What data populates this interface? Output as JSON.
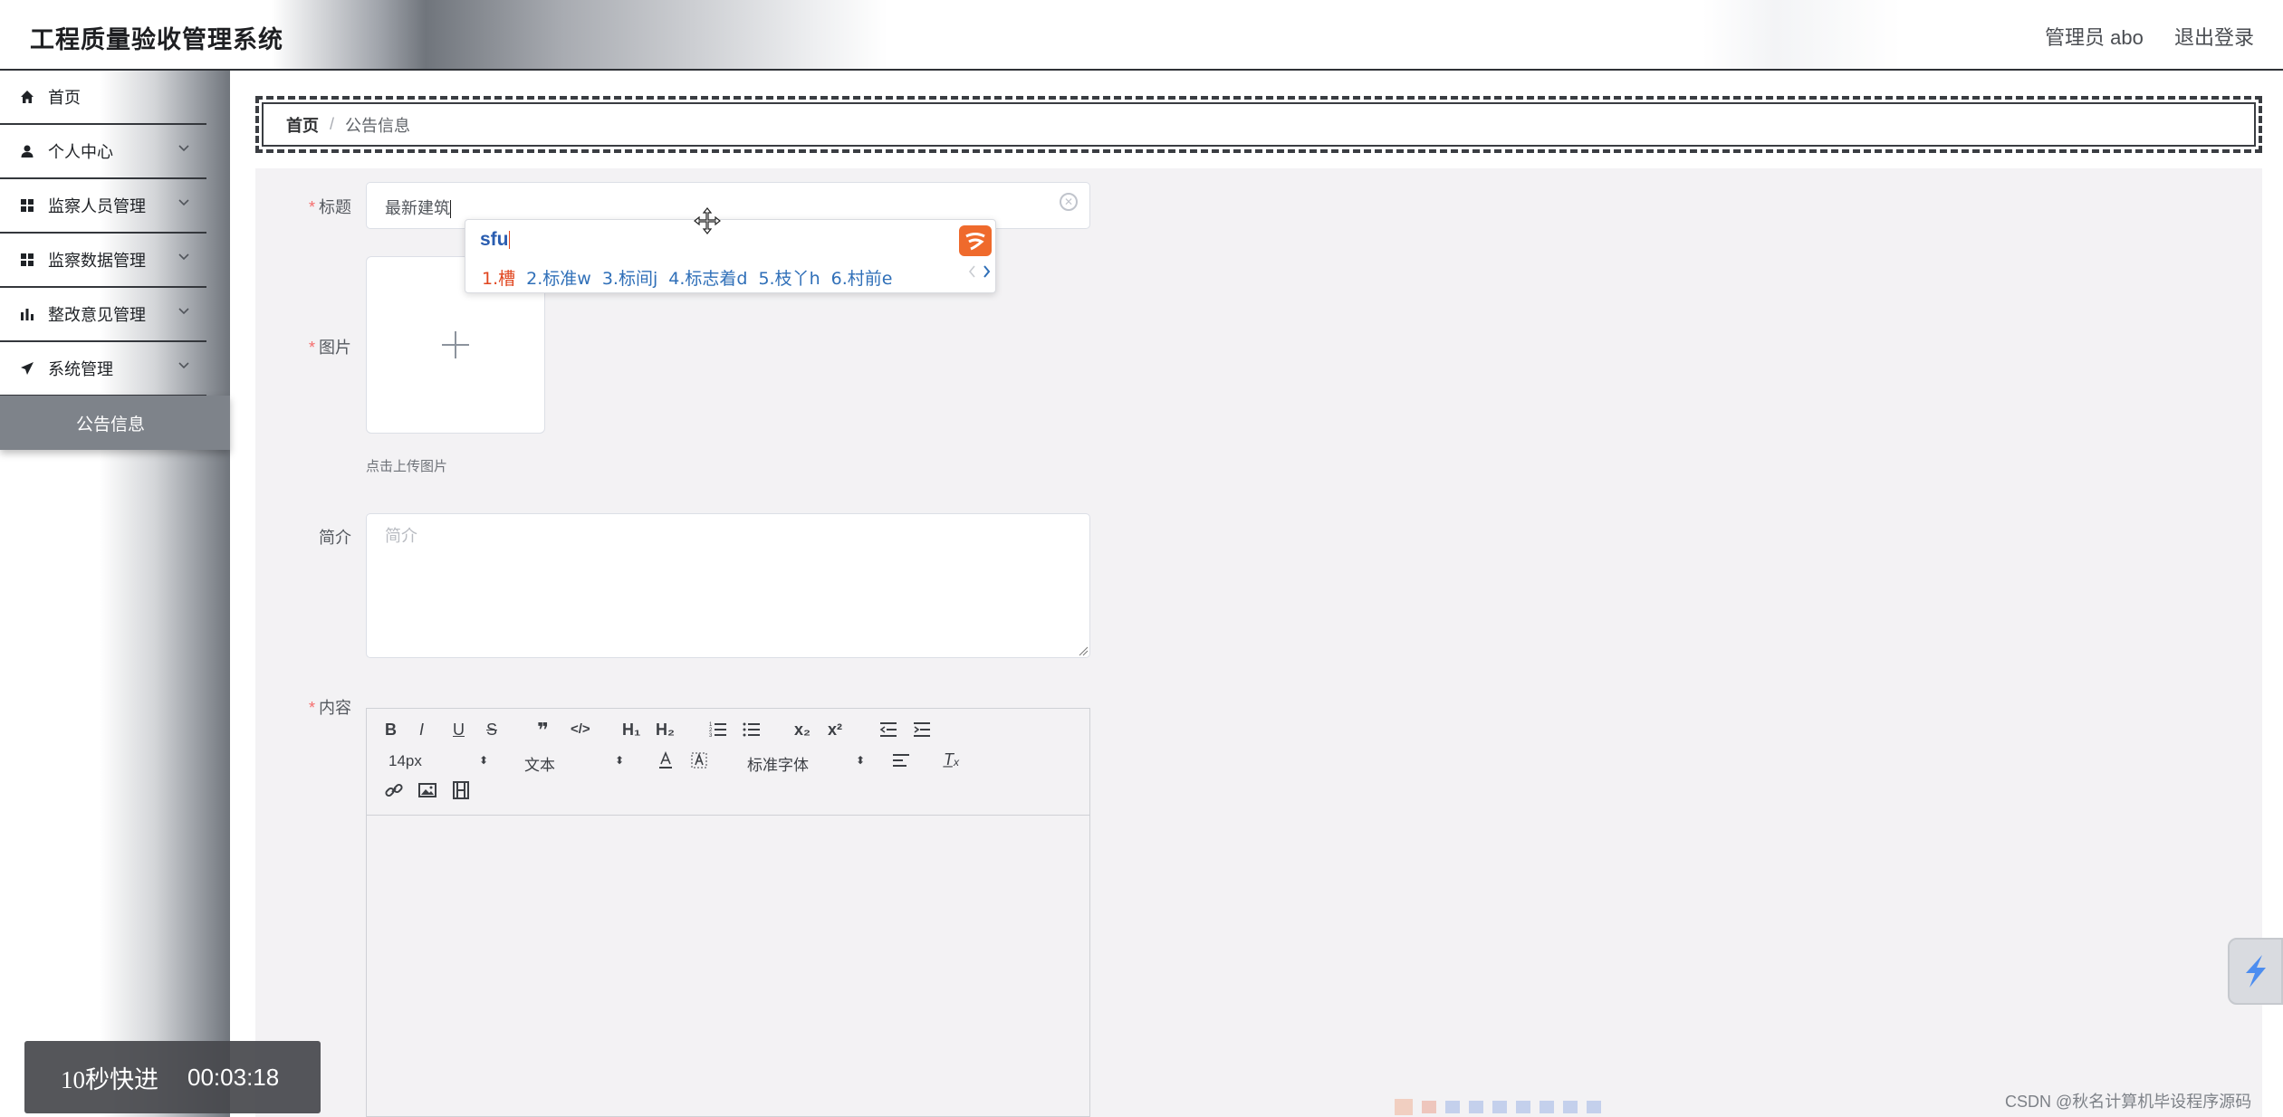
{
  "header": {
    "app_title": "工程质量验收管理系统",
    "admin_name": "管理员 abo",
    "logout_label": "退出登录"
  },
  "sidebar": {
    "items": [
      {
        "label": "首页",
        "icon": "home-icon"
      },
      {
        "label": "个人中心",
        "icon": "user-icon"
      },
      {
        "label": "监察人员管理",
        "icon": "grid-icon"
      },
      {
        "label": "监察数据管理",
        "icon": "grid-icon"
      },
      {
        "label": "整改意见管理",
        "icon": "bar-chart-icon"
      },
      {
        "label": "系统管理",
        "icon": "send-icon"
      }
    ],
    "active_sub": "公告信息"
  },
  "breadcrumb": {
    "home": "首页",
    "separator": "/",
    "current": "公告信息"
  },
  "form": {
    "title_label": "标题",
    "title_value": "最新建筑",
    "image_label": "图片",
    "upload_tip": "点击上传图片",
    "intro_label": "简介",
    "intro_placeholder": "简介",
    "content_label": "内容",
    "required_mark": "*"
  },
  "editor": {
    "font_size": "14px",
    "header_select": "文本",
    "font_family": "标准字体",
    "buttons": {
      "bold": "B",
      "italic": "I",
      "underline": "U",
      "strike": "S",
      "quote": "❞",
      "code": "</>",
      "h1": "H₁",
      "h2": "H₂",
      "sub": "x₂",
      "sup": "x²",
      "clear": "T̲ₓ"
    }
  },
  "ime": {
    "composition": "sfu",
    "candidates": [
      "1.槽",
      "2.标准w",
      "3.标间j",
      "4.标志着d",
      "5.枝丫h",
      "6.村前e"
    ]
  },
  "video": {
    "label": "10秒快进",
    "time": "00:03:18"
  },
  "watermark": "CSDN @秋名计算机毕设程序源码",
  "colors": {
    "required": "#f56c6c",
    "active_sub_bg": "#7e838a",
    "ime_first": "#e0451e",
    "ime_candidate": "#2f6fb8",
    "ime_logo": "#ef6a2c"
  }
}
